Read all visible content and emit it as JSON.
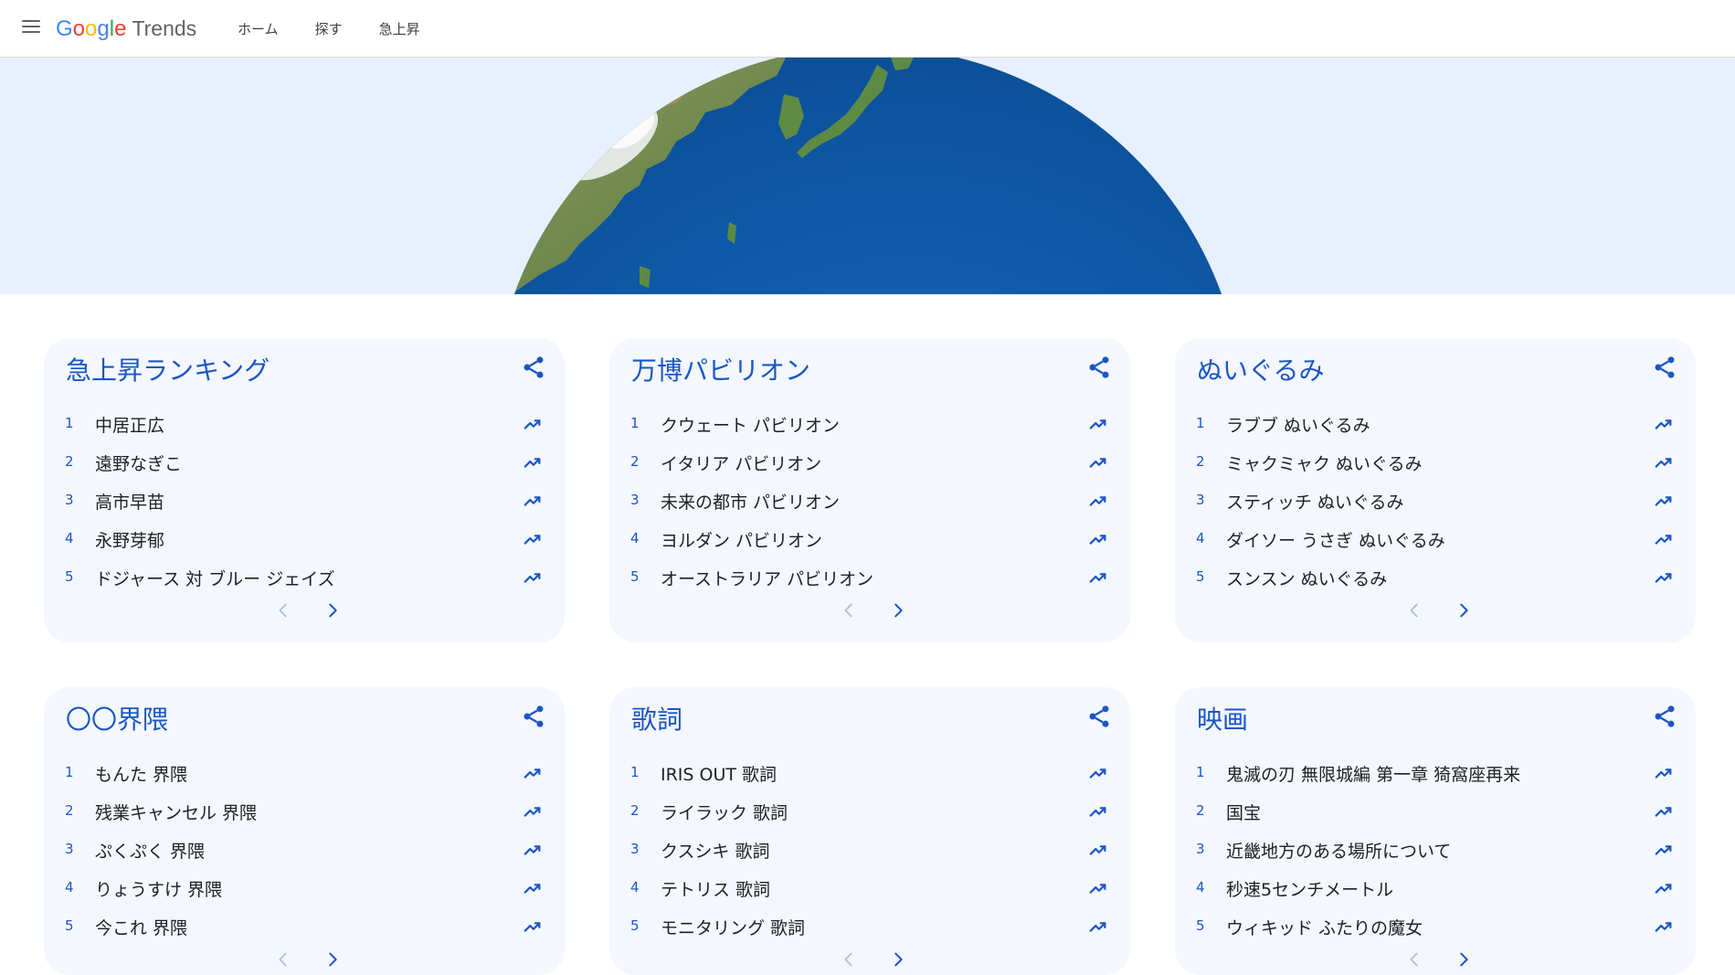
{
  "header": {
    "logo_letters": [
      {
        "ch": "G",
        "color": "#4285F4"
      },
      {
        "ch": "o",
        "color": "#EA4335"
      },
      {
        "ch": "o",
        "color": "#FBBC05"
      },
      {
        "ch": "g",
        "color": "#4285F4"
      },
      {
        "ch": "l",
        "color": "#34A853"
      },
      {
        "ch": "e",
        "color": "#EA4335"
      }
    ],
    "logo_product": "Trends",
    "nav": [
      "ホーム",
      "探す",
      "急上昇"
    ]
  },
  "cards": [
    {
      "title": "急上昇ランキング",
      "items": [
        "中居正広",
        "遠野なぎこ",
        "高市早苗",
        "永野芽郁",
        "ドジャース 対 ブルー ジェイズ"
      ]
    },
    {
      "title": "万博パビリオン",
      "items": [
        "クウェート パビリオン",
        "イタリア パビリオン",
        "未来の都市 パビリオン",
        "ヨルダン パビリオン",
        "オーストラリア パビリオン"
      ]
    },
    {
      "title": "ぬいぐるみ",
      "items": [
        "ラブブ ぬいぐるみ",
        "ミャクミャク ぬいぐるみ",
        "スティッチ ぬいぐるみ",
        "ダイソー うさぎ ぬいぐるみ",
        "スンスン ぬいぐるみ"
      ]
    },
    {
      "title": "〇〇界隈",
      "items": [
        "もんた 界隈",
        "残業キャンセル 界隈",
        "ぷくぷく 界隈",
        "りょうすけ 界隈",
        "今これ 界隈"
      ]
    },
    {
      "title": "歌詞",
      "items": [
        "IRIS OUT 歌詞",
        "ライラック 歌詞",
        "クスシキ 歌詞",
        "テトリス 歌詞",
        "モニタリング 歌詞"
      ]
    },
    {
      "title": "映画",
      "items": [
        "鬼滅の刃 無限城編 第一章 猗窩座再来",
        "国宝",
        "近畿地方のある場所について",
        "秒速5センチメートル",
        "ウィキッド ふたりの魔女"
      ]
    }
  ],
  "ranks": [
    "1",
    "2",
    "3",
    "4",
    "5"
  ],
  "colors": {
    "accent": "#1a56c4",
    "card_bg": "#f4f7fd",
    "hero_bg": "#e8f0fe"
  }
}
